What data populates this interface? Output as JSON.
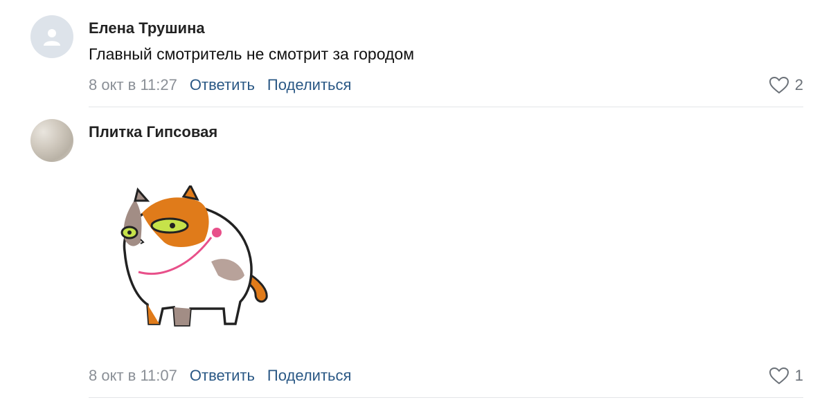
{
  "comments": [
    {
      "author": "Елена Трушина",
      "text": "Главный смотритель не смотрит за городом",
      "date": "8 окт в 11:27",
      "reply": "Ответить",
      "share": "Поделиться",
      "likes": "2"
    },
    {
      "author": "Плитка Гипсовая",
      "date": "8 окт в 11:07",
      "reply": "Ответить",
      "share": "Поделиться",
      "likes": "1",
      "sticker": "cat-sticker"
    }
  ],
  "icons": {
    "like": "heart-icon",
    "avatar_default": "user-silhouette-icon"
  },
  "colors": {
    "link": "#2a5885",
    "date": "#8a8f96",
    "divider": "#e3e5e8"
  }
}
